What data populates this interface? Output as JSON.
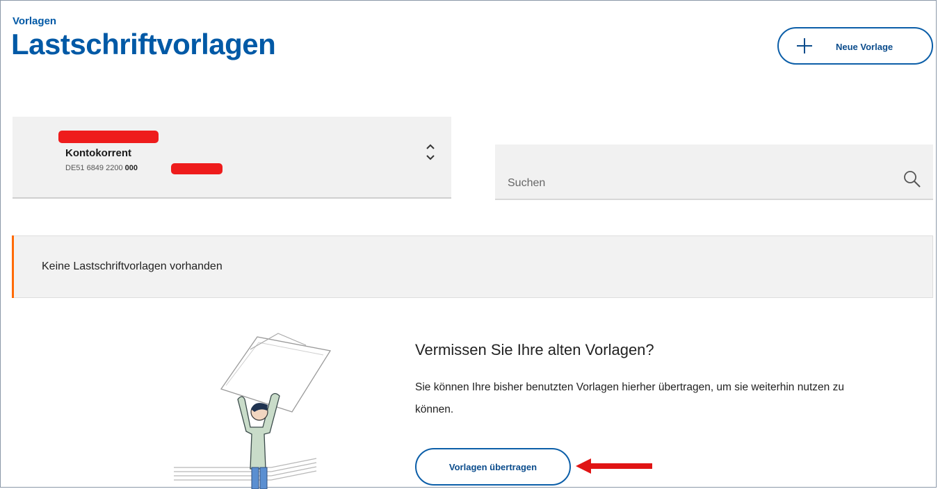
{
  "header": {
    "breadcrumb": "Vorlagen",
    "title": "Lastschriftvorlagen",
    "new_button_label": "Neue Vorlage",
    "new_button_icon": "plus-icon"
  },
  "account_selector": {
    "name": "Kontokorrent",
    "iban_prefix": "DE51 6849 2200 ",
    "iban_bold": "000",
    "icon": "chevron-up-down-icon"
  },
  "search": {
    "placeholder": "Suchen",
    "value": "",
    "icon": "search-icon"
  },
  "notice": {
    "text": "Keine Lastschriftvorlagen vorhanden",
    "accent_color": "#ff6a00"
  },
  "promo": {
    "heading": "Vermissen Sie Ihre alten Vorlagen?",
    "text": "Sie können Ihre bisher benutzten Vorlagen hierher übertragen, um sie weiterhin nutzen zu können.",
    "button_label": "Vorlagen übertragen",
    "illustration": "person-holding-paper-illustration",
    "annotation": "red-arrow-icon"
  },
  "colors": {
    "brand_blue": "#0059a6",
    "button_border": "#0b5ea8",
    "redaction": "#ee1c1c"
  }
}
